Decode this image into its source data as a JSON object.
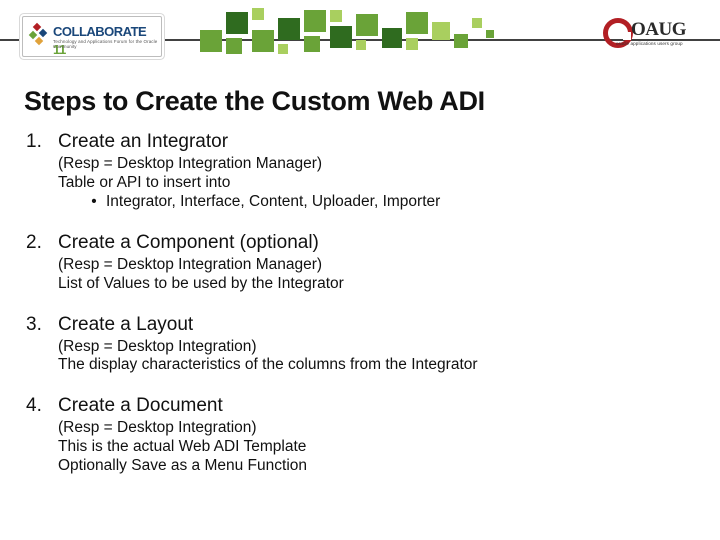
{
  "header": {
    "collab_main_a": "COLLABORATE",
    "collab_main_b": "11",
    "collab_tag": "Technology and Applications Forum for the Oracle Community",
    "oaug_name": "OAUG",
    "oaug_sub": "oracle applications users group"
  },
  "title": "Steps to Create the Custom Web ADI",
  "steps": [
    {
      "num": "1.",
      "head": "Create an Integrator",
      "lines": [
        "(Resp = Desktop Integration Manager)",
        "Table or API to insert into"
      ],
      "sublines": [
        "Integrator, Interface, Content, Uploader, Importer"
      ]
    },
    {
      "num": "2.",
      "head": "Create a Component (optional)",
      "lines": [
        "(Resp = Desktop Integration Manager)",
        "List of Values to be used by the Integrator"
      ],
      "sublines": []
    },
    {
      "num": "3.",
      "head": "Create a Layout",
      "lines": [
        "(Resp = Desktop Integration)",
        "The display characteristics of the columns from the Integrator"
      ],
      "sublines": []
    },
    {
      "num": "4.",
      "head": "Create a Document",
      "lines": [
        "(Resp = Desktop Integration)",
        "This is the actual Web ADI Template",
        "Optionally Save as a Menu Function"
      ],
      "sublines": []
    }
  ]
}
